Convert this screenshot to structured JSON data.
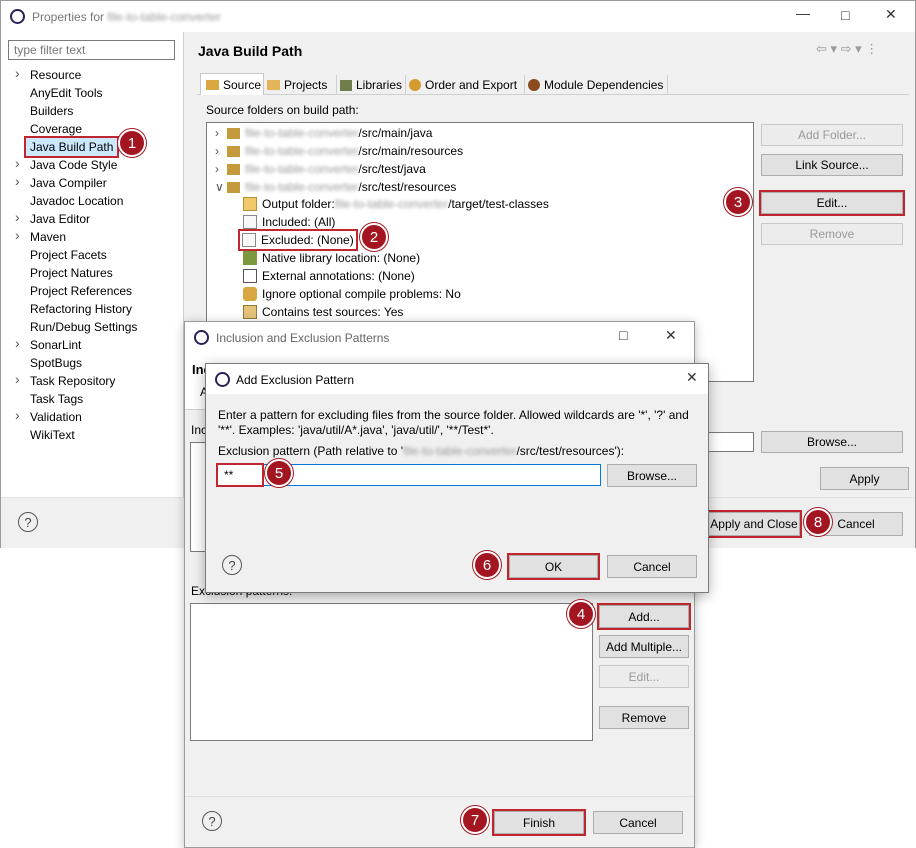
{
  "main_window": {
    "title_prefix": "Properties for",
    "title_project": "file-to-table-converter",
    "filter_placeholder": "type filter text",
    "nav_items": [
      {
        "label": "Resource",
        "chevron": true
      },
      {
        "label": "AnyEdit Tools",
        "chevron": false
      },
      {
        "label": "Builders",
        "chevron": false
      },
      {
        "label": "Coverage",
        "chevron": false
      },
      {
        "label": "Java Build Path",
        "chevron": false,
        "selected": true
      },
      {
        "label": "Java Code Style",
        "chevron": true
      },
      {
        "label": "Java Compiler",
        "chevron": true
      },
      {
        "label": "Javadoc Location",
        "chevron": false
      },
      {
        "label": "Java Editor",
        "chevron": true
      },
      {
        "label": "Maven",
        "chevron": true
      },
      {
        "label": "Project Facets",
        "chevron": false
      },
      {
        "label": "Project Natures",
        "chevron": false
      },
      {
        "label": "Project References",
        "chevron": false
      },
      {
        "label": "Refactoring History",
        "chevron": false
      },
      {
        "label": "Run/Debug Settings",
        "chevron": false
      },
      {
        "label": "SonarLint",
        "chevron": true
      },
      {
        "label": "SpotBugs",
        "chevron": false
      },
      {
        "label": "Task Repository",
        "chevron": true
      },
      {
        "label": "Task Tags",
        "chevron": false
      },
      {
        "label": "Validation",
        "chevron": true
      },
      {
        "label": "WikiText",
        "chevron": false
      }
    ],
    "page_title": "Java Build Path",
    "tabs": [
      "Source",
      "Projects",
      "Libraries",
      "Order and Export",
      "Module Dependencies"
    ],
    "source_label": "Source folders on build path:",
    "tree": [
      {
        "prefix": "file-to-table-converter",
        "suffix": "/src/main/java",
        "expanded": false
      },
      {
        "prefix": "file-to-table-converter",
        "suffix": "/src/main/resources",
        "expanded": false
      },
      {
        "prefix": "file-to-table-converter",
        "suffix": "/src/test/java",
        "expanded": false
      },
      {
        "prefix": "file-to-table-converter",
        "suffix": "/src/test/resources",
        "expanded": true
      }
    ],
    "tree_children": {
      "output_label": "Output folder: ",
      "output_project": "file-to-table-converter",
      "output_suffix": "/target/test-classes",
      "included": "Included: (All)",
      "excluded": "Excluded: (None)",
      "native": "Native library location: (None)",
      "external": "External annotations: (None)",
      "ignore": "Ignore optional compile problems: No",
      "contains": "Contains test sources: Yes"
    },
    "buttons": {
      "add_folder": "Add Folder...",
      "link_source": "Link Source...",
      "edit": "Edit...",
      "remove": "Remove",
      "browse": "Browse...",
      "apply": "Apply",
      "apply_close": "Apply and Close",
      "cancel": "Cancel"
    },
    "help": "?"
  },
  "inclusion_dialog": {
    "title": "Inclusion and Exclusion Patterns",
    "heading_partial": "Inc",
    "sub_partial": "A",
    "inclusion_partial": "Inc",
    "exclusion_label": "Exclusion patterns:",
    "buttons": {
      "add": "Add...",
      "add_multiple": "Add Multiple...",
      "edit": "Edit...",
      "remove": "Remove",
      "finish": "Finish",
      "cancel": "Cancel"
    },
    "help": "?"
  },
  "exclusion_dialog": {
    "title": "Add Exclusion Pattern",
    "description_line1": "Enter a pattern for excluding files from the source folder. Allowed wildcards are '*', '?' and",
    "description_line2": "'**'. Examples: 'java/util/A*.java', 'java/util/', '**/Test*'.",
    "pattern_label_prefix": "Exclusion pattern (Path relative to '",
    "pattern_label_project": "file-to-table-converter",
    "pattern_label_suffix": "/src/test/resources'):",
    "pattern_value": "**",
    "buttons": {
      "browse": "Browse...",
      "ok": "OK",
      "cancel": "Cancel"
    },
    "help": "?"
  },
  "badges": [
    "1",
    "2",
    "3",
    "4",
    "5",
    "6",
    "7",
    "8"
  ],
  "colors": {
    "highlight": "#c0262d",
    "badge": "#a31621",
    "tab_active": "#ffffff",
    "accent": "#0078d7"
  }
}
